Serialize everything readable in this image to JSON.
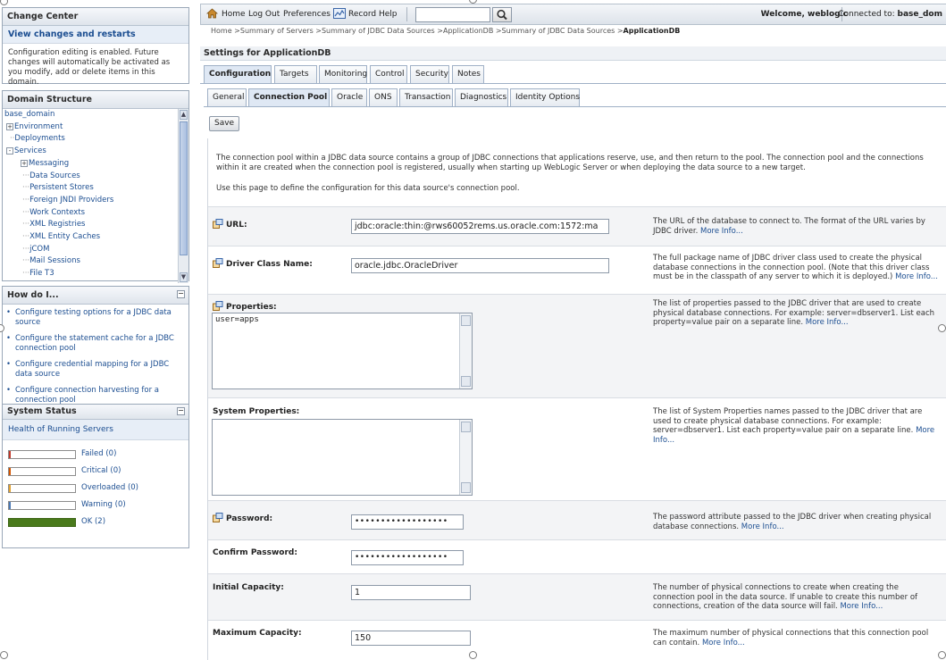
{
  "change_center": {
    "title": "Change Center",
    "link": "View changes and restarts",
    "text": "Configuration editing is enabled. Future changes will automatically be activated as you modify, add or delete items in this domain."
  },
  "domain_structure": {
    "title": "Domain Structure",
    "items": [
      {
        "label": "base_domain",
        "expander": "",
        "depth": 0
      },
      {
        "label": "Environment",
        "expander": "+",
        "depth": 1
      },
      {
        "label": "Deployments",
        "expander": "",
        "depth": 1
      },
      {
        "label": "Services",
        "expander": "-",
        "depth": 1
      },
      {
        "label": "Messaging",
        "expander": "+",
        "depth": 2
      },
      {
        "label": "Data Sources",
        "expander": "",
        "depth": 2
      },
      {
        "label": "Persistent Stores",
        "expander": "",
        "depth": 2
      },
      {
        "label": "Foreign JNDI Providers",
        "expander": "",
        "depth": 2
      },
      {
        "label": "Work Contexts",
        "expander": "",
        "depth": 2
      },
      {
        "label": "XML Registries",
        "expander": "",
        "depth": 2
      },
      {
        "label": "XML Entity Caches",
        "expander": "",
        "depth": 2
      },
      {
        "label": "jCOM",
        "expander": "",
        "depth": 2
      },
      {
        "label": "Mail Sessions",
        "expander": "",
        "depth": 2
      },
      {
        "label": "File T3",
        "expander": "",
        "depth": 2
      }
    ]
  },
  "how_do_i": {
    "title": "How do I...",
    "items": [
      "Configure testing options for a JDBC data source",
      "Configure the statement cache for a JDBC connection pool",
      "Configure credential mapping for a JDBC data source",
      "Configure connection harvesting for a connection pool"
    ]
  },
  "system_status": {
    "title": "System Status",
    "subtitle": "Health of Running Servers",
    "rows": [
      {
        "label": "Failed (0)",
        "color": "#c0392b",
        "fill": 0
      },
      {
        "label": "Critical (0)",
        "color": "#d35400",
        "fill": 0
      },
      {
        "label": "Overloaded (0)",
        "color": "#e0a030",
        "fill": 0
      },
      {
        "label": "Warning (0)",
        "color": "#4a78b5",
        "fill": 0
      },
      {
        "label": "OK (2)",
        "color": "#4a7a1c",
        "fill": 1
      }
    ]
  },
  "topbar": {
    "home": "Home",
    "logout": "Log Out",
    "preferences": "Preferences",
    "record": "Record",
    "help": "Help",
    "search_value": "",
    "welcome": "Welcome, weblogic",
    "connected_label": "Connected to:",
    "connected_domain": "base_dom"
  },
  "breadcrumb": {
    "path": "Home >Summary of Servers >Summary of JDBC Data Sources >ApplicationDB >Summary of JDBC Data Sources >",
    "current": "ApplicationDB"
  },
  "settings_title": "Settings for ApplicationDB",
  "tabs_primary": [
    "Configuration",
    "Targets",
    "Monitoring",
    "Control",
    "Security",
    "Notes"
  ],
  "tabs_secondary": [
    "General",
    "Connection Pool",
    "Oracle",
    "ONS",
    "Transaction",
    "Diagnostics",
    "Identity Options"
  ],
  "save_label": "Save",
  "intro": {
    "p1": "The connection pool within a JDBC data source contains a group of JDBC connections that applications reserve, use, and then return to the pool. The connection pool and the connections within it are created when the connection pool is registered, usually when starting up WebLogic Server or when deploying the data source to a new target.",
    "p2": "Use this page to define the configuration for this data source's connection pool."
  },
  "fields": {
    "url": {
      "label": "URL:",
      "value": "jdbc:oracle:thin:@rws60052rems.us.oracle.com:1572:ma",
      "help": "The URL of the database to connect to. The format of the URL varies by JDBC driver.",
      "more": "More Info..."
    },
    "driver": {
      "label": "Driver Class Name:",
      "value": "oracle.jdbc.OracleDriver",
      "help": "The full package name of JDBC driver class used to create the physical database connections in the connection pool. (Note that this driver class must be in the classpath of any server to which it is deployed.)",
      "more": "More Info..."
    },
    "properties": {
      "label": "Properties:",
      "value": "user=apps",
      "help": "The list of properties passed to the JDBC driver that are used to create physical database connections. For example: server=dbserver1. List each property=value pair on a separate line.",
      "more": "More Info..."
    },
    "system_properties": {
      "label": "System Properties:",
      "value": "",
      "help": "The list of System Properties names passed to the JDBC driver that are used to create physical database connections. For example: server=dbserver1. List each property=value pair on a separate line.",
      "more": "More Info..."
    },
    "password": {
      "label": "Password:",
      "value": "••••••••••••••••••",
      "help": "The password attribute passed to the JDBC driver when creating physical database connections.",
      "more": "More Info..."
    },
    "confirm_password": {
      "label": "Confirm Password:",
      "value": "••••••••••••••••••"
    },
    "initial_capacity": {
      "label": "Initial Capacity:",
      "value": "1",
      "help": "The number of physical connections to create when creating the connection pool in the data source. If unable to create this number of connections, creation of the data source will fail.",
      "more": "More Info..."
    },
    "maximum_capacity": {
      "label": "Maximum Capacity:",
      "value": "150",
      "help": "The maximum number of physical connections that this connection pool can contain.",
      "more": "More Info..."
    }
  },
  "icons": {
    "home": "home-icon",
    "record": "record-icon",
    "search": "search-icon",
    "field": "field-config-icon"
  }
}
